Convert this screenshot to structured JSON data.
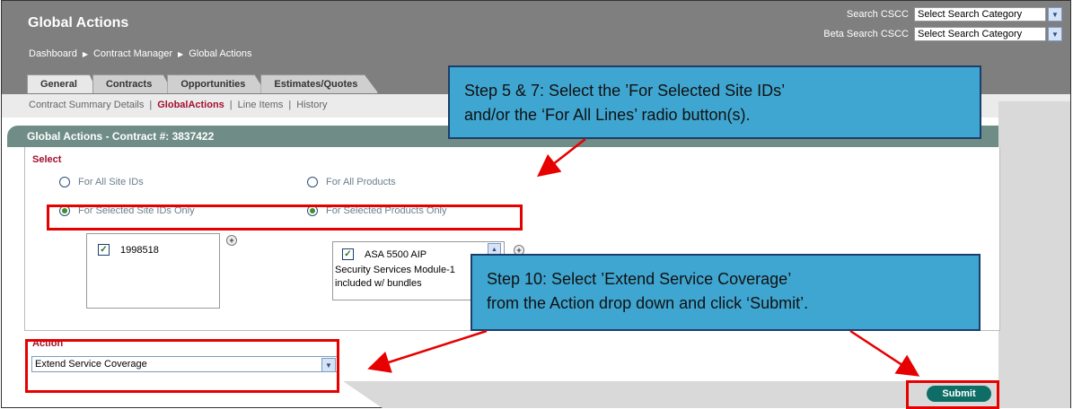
{
  "page": {
    "title": "Global Actions",
    "breadcrumb": [
      "Dashboard",
      "Contract Manager",
      "Global Actions"
    ]
  },
  "search": {
    "cscc_label": "Search CSCC",
    "cscc_value": "Select Search Category",
    "beta_label": "Beta Search CSCC",
    "beta_value": "Select Search Category"
  },
  "tabs": [
    {
      "label": "General"
    },
    {
      "label": "Contracts"
    },
    {
      "label": "Opportunities"
    },
    {
      "label": "Estimates/Quotes"
    }
  ],
  "subnav": {
    "items": [
      "Contract Summary Details",
      "GlobalActions",
      "Line Items",
      "History"
    ],
    "separator": "|"
  },
  "section": {
    "title": "Global Actions - Contract #: 3837422"
  },
  "select": {
    "label": "Select",
    "all_sites": "For All Site IDs",
    "selected_sites": "For Selected Site IDs Only",
    "all_products": "For All Products",
    "selected_products": "For Selected Products Only"
  },
  "sites": {
    "items": [
      {
        "id": "1998518",
        "checked": true
      }
    ]
  },
  "products": {
    "item_title": "ASA 5500 AIP",
    "item_desc1": "Security Services Module-1",
    "item_desc2": "included w/ bundles"
  },
  "action": {
    "label": "Action",
    "value": "Extend Service Coverage"
  },
  "submit_label": "Submit",
  "callouts": {
    "step5_line1": "Step 5 & 7: Select the ’For Selected Site IDs’",
    "step5_line2": "and/or the ‘For All Lines’ radio button(s).",
    "step10_line1": "Step 10: Select ’Extend Service Coverage’",
    "step10_line2": "from the Action drop down and click ‘Submit’."
  },
  "colors": {
    "header_gray": "#7f7f7f",
    "accent_red": "#a30f2d",
    "bar_teal": "#6f8d86",
    "submit_green": "#0e6e66",
    "callout_blue": "#3fa6d1",
    "highlight_red": "#e60000"
  }
}
